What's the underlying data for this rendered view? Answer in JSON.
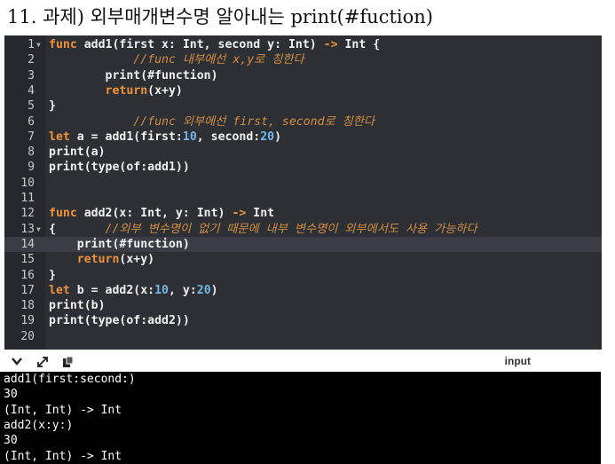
{
  "title": "11. 과제) 외부매개변수명 알아내는 print(#fuction)",
  "editor": {
    "lines": [
      {
        "n": "1",
        "fold": true
      },
      {
        "n": "2"
      },
      {
        "n": "3"
      },
      {
        "n": "4"
      },
      {
        "n": "5"
      },
      {
        "n": "6"
      },
      {
        "n": "7"
      },
      {
        "n": "8"
      },
      {
        "n": "9"
      },
      {
        "n": "10"
      },
      {
        "n": "11"
      },
      {
        "n": "12"
      },
      {
        "n": "13",
        "fold": true
      },
      {
        "n": "14"
      },
      {
        "n": "15"
      },
      {
        "n": "16"
      },
      {
        "n": "17"
      },
      {
        "n": "18"
      },
      {
        "n": "19"
      },
      {
        "n": "20"
      }
    ],
    "active_line": 14,
    "code": {
      "l1": [
        "func",
        " add1(first x: Int, second y: Int) ",
        "->",
        " Int {"
      ],
      "l2": "            //func 내부에선 x,y로 칭한다",
      "l3": "        print(#function)",
      "l4_kw": "        return",
      "l4_rest": "(x+y)",
      "l5": "}",
      "l6": "            //func 외부에선 first, second로 칭한다",
      "l7": [
        "let",
        " a = add1(first:",
        "10",
        ", second:",
        "20",
        ")"
      ],
      "l8": "print(a)",
      "l9": "print(type(of:add1))",
      "l12": [
        "func",
        " add2(x: Int, y: Int) ",
        "->",
        " Int"
      ],
      "l13": [
        "{",
        "       //외부 변수명이 없기 때문에 내부 변수명이 외부에서도 사용 가능하다"
      ],
      "l14": "    print(#function)",
      "l15_kw": "    return",
      "l15_rest": "(x+y)",
      "l16": "}",
      "l17": [
        "let",
        " b = add2(x:",
        "10",
        ", y:",
        "20",
        ")"
      ],
      "l18": "print(b)",
      "l19": "print(type(of:add2))"
    }
  },
  "toolbar": {
    "icons": [
      "chevron-down-icon",
      "expand-icon",
      "paste-icon"
    ],
    "input_label": "input"
  },
  "console": {
    "lines": [
      "add1(first:second:)",
      "30",
      "(Int, Int) -> Int",
      "add2(x:y:)",
      "30",
      "(Int, Int) -> Int"
    ]
  }
}
